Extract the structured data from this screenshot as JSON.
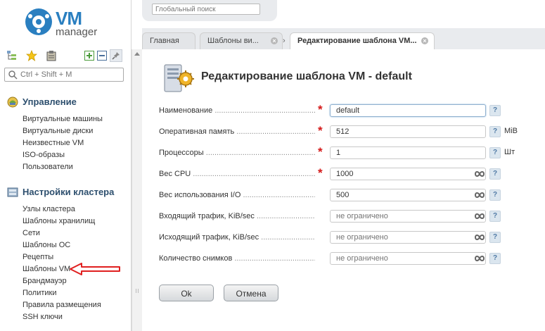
{
  "logo": {
    "brand": "VM",
    "product": "manager"
  },
  "sidebar": {
    "search_placeholder": "Ctrl + Shift + M",
    "sections": [
      {
        "title": "Управление",
        "items": [
          "Виртуальные машины",
          "Виртуальные диски",
          "Неизвестные VM",
          "ISO-образы",
          "Пользователи"
        ]
      },
      {
        "title": "Настройки кластера",
        "items": [
          "Узлы кластера",
          "Шаблоны хранилищ",
          "Сети",
          "Шаблоны ОС",
          "Рецепты",
          "Шаблоны VM",
          "Брандмауэр",
          "Политики",
          "Правила размещения",
          "SSH ключи"
        ]
      }
    ]
  },
  "header": {
    "global_search_placeholder": "Глобальный поиск"
  },
  "tabs": [
    {
      "label": "Главная"
    },
    {
      "label": "Шаблоны ви..."
    },
    {
      "label": "Редактирование шаблона VM..."
    }
  ],
  "form": {
    "title": "Редактирование шаблона VM - default",
    "fields": [
      {
        "label": "Наименование",
        "value": "default",
        "required": true,
        "unit": "",
        "unlimited_icon": false
      },
      {
        "label": "Оперативная память",
        "value": "512",
        "required": true,
        "unit": "MiB",
        "unlimited_icon": false
      },
      {
        "label": "Процессоры",
        "value": "1",
        "required": true,
        "unit": "Шт",
        "unlimited_icon": false
      },
      {
        "label": "Вес CPU",
        "value": "1000",
        "required": true,
        "unit": "",
        "unlimited_icon": true
      },
      {
        "label": "Вес использования I/O",
        "value": "500",
        "required": false,
        "unit": "",
        "unlimited_icon": true
      },
      {
        "label": "Входящий трафик, KiB/sec",
        "value": "",
        "placeholder": "не ограничено",
        "required": false,
        "unit": "",
        "unlimited_icon": true
      },
      {
        "label": "Исходящий трафик, KiB/sec",
        "value": "",
        "placeholder": "не ограничено",
        "required": false,
        "unit": "",
        "unlimited_icon": true
      },
      {
        "label": "Количество снимков",
        "value": "",
        "placeholder": "не ограничено",
        "required": false,
        "unit": "",
        "unlimited_icon": true
      }
    ],
    "help_glyph": "?",
    "required_glyph": "*",
    "ok_label": "Ok",
    "cancel_label": "Отмена"
  },
  "colors": {
    "brand": "#2a7fc0",
    "required": "#d41818",
    "annotation_arrow": "#e02020"
  }
}
